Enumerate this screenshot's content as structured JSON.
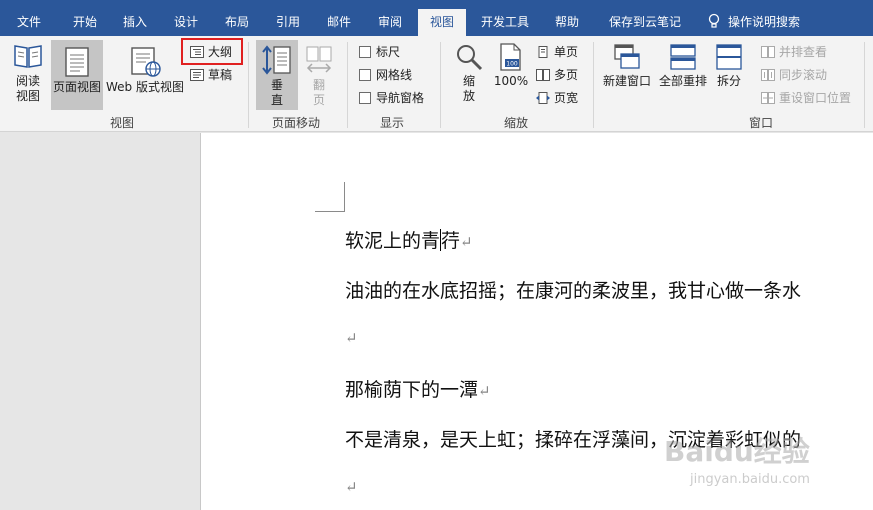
{
  "menu": {
    "tabs": [
      "文件",
      "开始",
      "插入",
      "设计",
      "布局",
      "引用",
      "邮件",
      "审阅",
      "视图",
      "开发工具",
      "帮助",
      "保存到云笔记"
    ],
    "active_tab": "视图",
    "tell_me": "操作说明搜索"
  },
  "ribbon": {
    "views": {
      "group_label": "视图",
      "reading_line1": "阅读",
      "reading_line2": "视图",
      "print_layout": "页面视图",
      "web_layout": "Web 版式视图",
      "outline": "大纲",
      "draft": "草稿"
    },
    "page_move": {
      "group_label": "页面移动",
      "vertical_1": "垂",
      "vertical_2": "直",
      "side_1": "翻",
      "side_2": "页"
    },
    "show": {
      "group_label": "显示",
      "ruler": "标尺",
      "gridlines": "网格线",
      "nav_pane": "导航窗格"
    },
    "zoom": {
      "group_label": "缩放",
      "zoom_1": "缩",
      "zoom_2": "放",
      "hundred": "100%",
      "one_page": "单页",
      "multi_page": "多页",
      "page_width": "页宽"
    },
    "window": {
      "group_label": "窗口",
      "new_window": "新建窗口",
      "arrange_all": "全部重排",
      "split": "拆分",
      "side_by_side": "并排查看",
      "sync_scroll": "同步滚动",
      "reset_position": "重设窗口位置"
    }
  },
  "document": {
    "line1": "软泥上的青",
    "line1b": "荇",
    "line2": "油油的在水底招摇；在康河的柔波里，我甘心做一条水",
    "line3": "那榆荫下的一潭",
    "line4": "不是清泉，是天上虹；揉碎在浮藻间，沉淀着彩虹似的",
    "para_mark": "↵"
  },
  "watermark": {
    "brand": "Baidu经验",
    "url": "jingyan.baidu.com"
  }
}
